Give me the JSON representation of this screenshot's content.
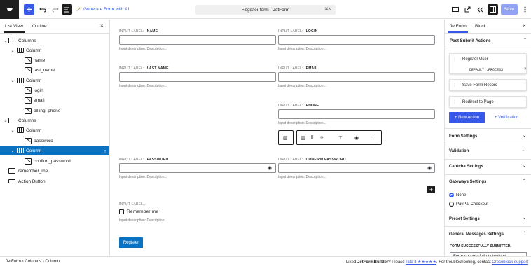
{
  "topbar": {
    "title": "Register form · JetForm",
    "shortcut": "⌘K",
    "generate_label": "Generate Form with AI",
    "save": "Save"
  },
  "left": {
    "tab_list": "List View",
    "tab_outline": "Outline",
    "close": "×",
    "tree": [
      {
        "label": "Columns"
      },
      {
        "label": "Column"
      },
      {
        "label": "name"
      },
      {
        "label": "last_name"
      },
      {
        "label": "Column"
      },
      {
        "label": "login"
      },
      {
        "label": "email"
      },
      {
        "label": "billing_phone"
      },
      {
        "label": "Columns"
      },
      {
        "label": "Column"
      },
      {
        "label": "password"
      },
      {
        "label": "Column"
      },
      {
        "label": "confirm_password"
      },
      {
        "label": "remember_me"
      },
      {
        "label": "Action Button"
      }
    ]
  },
  "form": {
    "label_prefix": "INPUT LABEL:",
    "desc": "Input description:  Description...",
    "name": "NAME",
    "login": "LOGIN",
    "last_name": "LAST NAME",
    "email": "EMAIL",
    "phone": "PHONE",
    "password": "PASSWORD",
    "confirm_password": "CONFIRM PASSWORD",
    "empty_label": "INPUT LABEL...",
    "remember": "Remember me",
    "register": "Register"
  },
  "right": {
    "tab_jetform": "JetForm",
    "tab_block": "Block",
    "close": "×",
    "post_submit": "Post Submit Actions",
    "actions": [
      {
        "label": "Register User"
      },
      {
        "label": "Save Form Record"
      },
      {
        "label": "Redirect to Page"
      }
    ],
    "default_process": "DEFAULT::PROCESS",
    "new_action": "+ New Action",
    "verification": "+ Verification",
    "sections": [
      "Form Settings",
      "Validation",
      "Captcha Settings",
      "Gateways Settings"
    ],
    "gateway_none": "None",
    "gateway_paypal": "PayPal Checkout",
    "preset": "Preset Settings",
    "messages": "General Messages Settings",
    "success_label": "FORM SUCCESSFULLY SUBMITTED.",
    "success_value": "Form successfully submitted."
  },
  "status": {
    "crumb1": "JetForm",
    "crumb2": "Columns",
    "crumb3": "Column",
    "msg_a": "Liked ",
    "msg_b": "JetFormBuilder",
    "msg_c": "? Please ",
    "msg_d": "rate it ★★★★★",
    "msg_e": ". For troubleshooting, contact ",
    "msg_f": "Crocoblock support"
  }
}
